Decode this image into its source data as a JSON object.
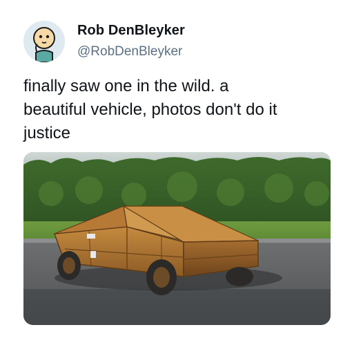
{
  "author": {
    "name": "Rob DenBleyker",
    "handle": "@RobDenBleyker"
  },
  "tweet": {
    "lines": [
      "finally saw one in the wild. a",
      "beautiful vehicle, photos don't do it",
      "justice"
    ]
  },
  "media": {
    "icon": "photo-dumpster-on-wheels"
  },
  "colors": {
    "text": "#0f1419",
    "muted": "#5b7083",
    "background": "#ffffff"
  }
}
